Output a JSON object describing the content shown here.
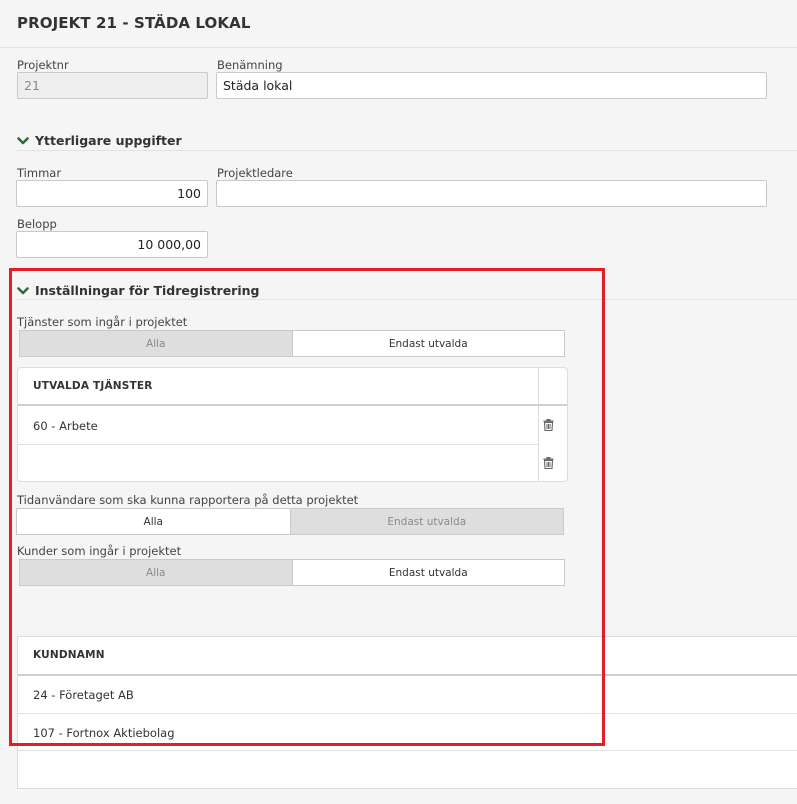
{
  "page": {
    "title": "PROJEKT 21 - STÄDA LOKAL"
  },
  "fields": {
    "projektnr_label": "Projektnr",
    "projektnr_value": "21",
    "benamning_label": "Benämning",
    "benamning_value": "Städa lokal"
  },
  "extra": {
    "heading": "Ytterligare uppgifter",
    "timmar_label": "Timmar",
    "timmar_value": "100",
    "projektledare_label": "Projektledare",
    "projektledare_value": "",
    "belopp_label": "Belopp",
    "belopp_value": "10 000,00"
  },
  "tid": {
    "heading": "Inställningar för Tidregistrering",
    "services_label": "Tjänster som ingår i projektet",
    "services_toggle": {
      "all": "Alla",
      "selected": "Endast utvalda",
      "active": "selected"
    },
    "services_table": {
      "header": "UTVALDA TJÄNSTER",
      "rows": [
        "60 - Arbete",
        ""
      ]
    },
    "users_label": "Tidanvändare som ska kunna rapportera på detta projektet",
    "users_toggle": {
      "all": "Alla",
      "selected": "Endast utvalda",
      "active": "all"
    },
    "customers_label": "Kunder som ingår i projektet",
    "customers_toggle": {
      "all": "Alla",
      "selected": "Endast utvalda",
      "active": "selected"
    },
    "customers_table": {
      "header": "KUNDNAMN",
      "rows": [
        "24 - Företaget AB",
        "107 - Fortnox Aktiebolag"
      ]
    }
  },
  "colors": {
    "accent_green": "#2e6b3c",
    "highlight_red": "#e31e24"
  },
  "icons": {
    "chevron": "chevron-down-icon",
    "trash": "trash-icon"
  }
}
